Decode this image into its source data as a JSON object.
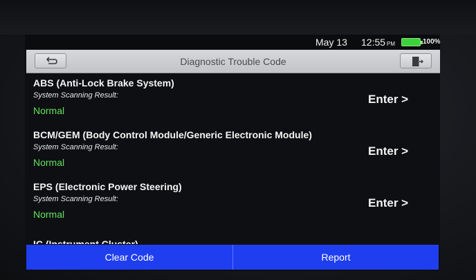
{
  "status": {
    "date": "May 13",
    "time": "12:55",
    "ampm": "PM",
    "battery": "100%"
  },
  "header": {
    "title": "Diagnostic Trouble Code",
    "back_icon": "back-arrow-icon",
    "exit_icon": "exit-door-icon"
  },
  "items": [
    {
      "name": "ABS (Anti-Lock Brake System)",
      "sub": "System Scanning Result:",
      "status": "Normal",
      "enter": "Enter >"
    },
    {
      "name": "BCM/GEM (Body Control Module/Generic Electronic Module)",
      "sub": "System Scanning Result:",
      "status": "Normal",
      "enter": "Enter >"
    },
    {
      "name": "EPS (Electronic Power Steering)",
      "sub": "System Scanning Result:",
      "status": "Normal",
      "enter": "Enter >"
    },
    {
      "name": "IC (Instrument Cluster)"
    }
  ],
  "footer": {
    "clear_label": "Clear Code",
    "report_label": "Report"
  },
  "colors": {
    "accent": "#1f3ef0",
    "status_ok": "#62e25e",
    "battery": "#3cd33c"
  }
}
